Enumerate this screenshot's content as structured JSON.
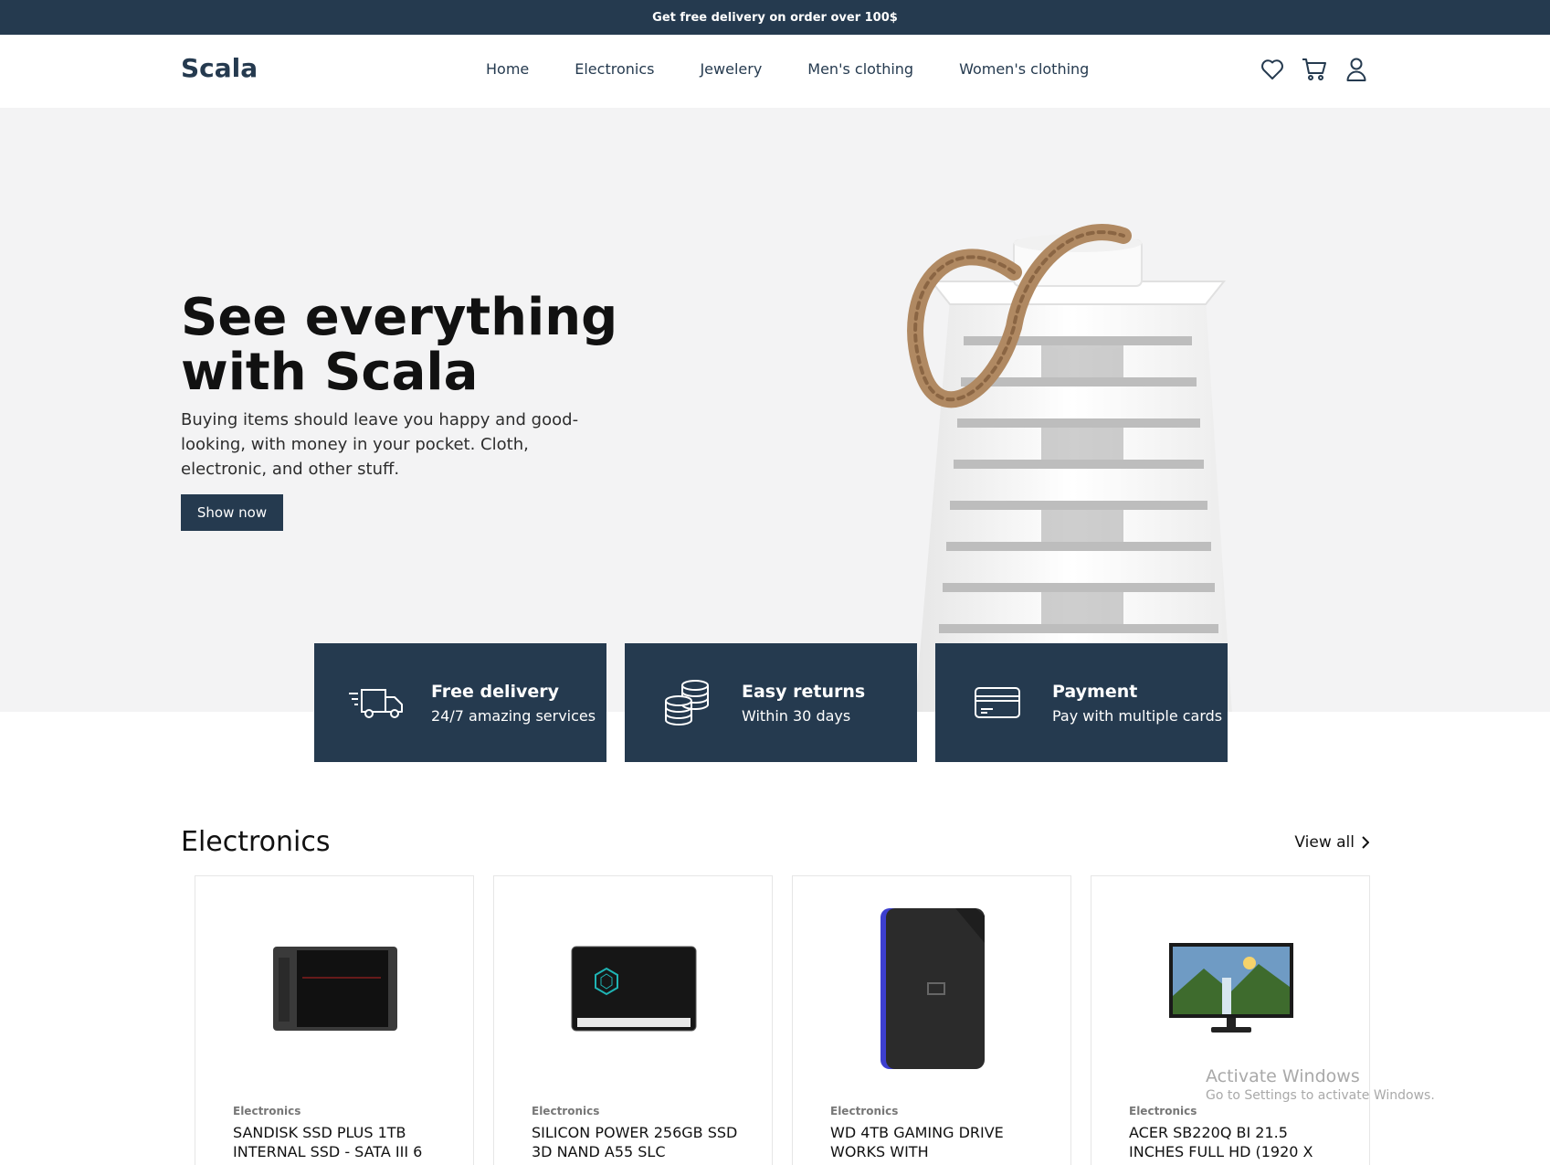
{
  "promo": {
    "text": "Get free delivery on order over 100$"
  },
  "header": {
    "logo": "Scala",
    "nav": [
      "Home",
      "Electronics",
      "Jewelery",
      "Men's clothing",
      "Women's clothing"
    ],
    "icons": [
      "heart-icon",
      "cart-icon",
      "user-icon"
    ]
  },
  "hero": {
    "title": "See everything with Scala",
    "text": "Buying items should leave you happy and good-looking, with money in your pocket. Cloth, electronic, and other stuff.",
    "button": "Show now"
  },
  "features": [
    {
      "icon": "delivery-truck-icon",
      "title": "Free delivery",
      "subtitle": "24/7 amazing services"
    },
    {
      "icon": "coins-icon",
      "title": "Easy returns",
      "subtitle": "Within 30 days"
    },
    {
      "icon": "credit-card-icon",
      "title": "Payment",
      "subtitle": "Pay with multiple cards"
    }
  ],
  "electronics": {
    "title": "Electronics",
    "view_all": "View all",
    "products": [
      {
        "category": "Electronics",
        "name": "SANDISK SSD PLUS 1TB INTERNAL SSD - SATA III 6"
      },
      {
        "category": "Electronics",
        "name": "SILICON POWER 256GB SSD 3D NAND A55 SLC"
      },
      {
        "category": "Electronics",
        "name": "WD 4TB GAMING DRIVE WORKS WITH"
      },
      {
        "category": "Electronics",
        "name": "ACER SB220Q BI 21.5 INCHES FULL HD (1920 X"
      }
    ]
  },
  "watermark": {
    "line1": "Activate Windows",
    "line2": "Go to Settings to activate Windows."
  },
  "colors": {
    "primary": "#253a4f",
    "hero_bg": "#f3f3f4"
  }
}
